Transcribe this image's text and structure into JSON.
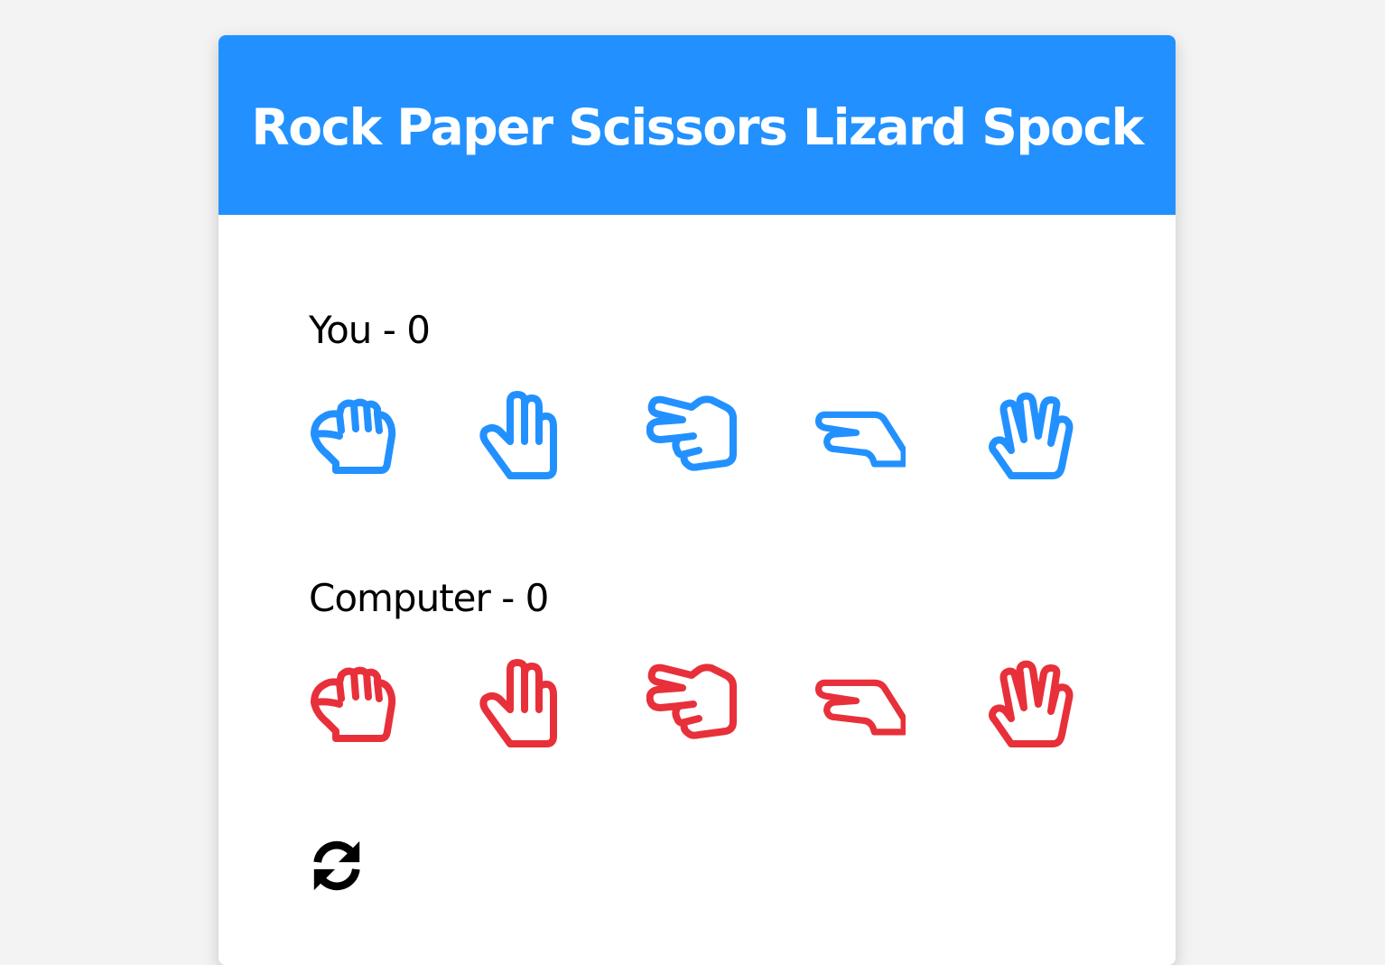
{
  "header": {
    "title": "Rock Paper Scissors Lizard Spock"
  },
  "player": {
    "label": "You - 0",
    "color": "#2291ff",
    "choices": [
      "rock-icon",
      "paper-icon",
      "scissors-icon",
      "lizard-icon",
      "spock-icon"
    ]
  },
  "computer": {
    "label": "Computer - 0",
    "color": "#e8303a",
    "choices": [
      "rock-icon",
      "paper-icon",
      "scissors-icon",
      "lizard-icon",
      "spock-icon"
    ]
  },
  "reset": {
    "icon": "refresh-icon"
  },
  "colors": {
    "header_bg": "#2291ff",
    "background": "#f3f3f3"
  }
}
